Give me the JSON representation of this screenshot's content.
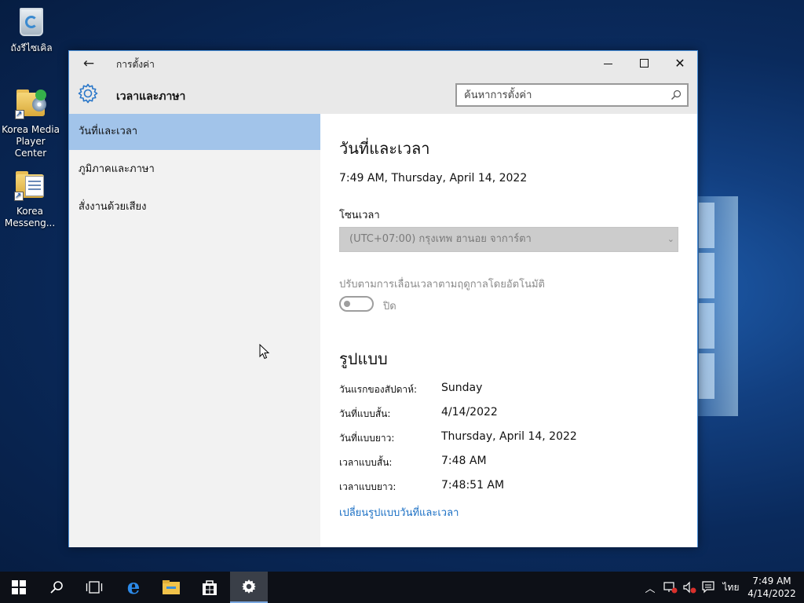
{
  "desktop": {
    "icons": [
      {
        "label": "ถังรีไซเคิล"
      },
      {
        "label": "Korea Media Player Center"
      },
      {
        "label": "Korea Messeng..."
      }
    ]
  },
  "window": {
    "title": "การตั้งค่า",
    "section_title": "เวลาและภาษา",
    "search_placeholder": "ค้นหาการตั้งค่า"
  },
  "nav": {
    "items": [
      {
        "label": "วันที่และเวลา",
        "active": true
      },
      {
        "label": "ภูมิภาคและภาษา",
        "active": false
      },
      {
        "label": "สั่งงานด้วยเสียง",
        "active": false
      }
    ]
  },
  "content": {
    "heading": "วันที่และเวลา",
    "current_datetime": "7:49 AM, Thursday, April 14, 2022",
    "timezone_label": "โซนเวลา",
    "timezone_value": "(UTC+07:00) กรุงเทพ ฮานอย จาการ์ตา",
    "dst_label": "ปรับตามการเลื่อนเวลาตามฤดูกาลโดยอัตโนมัติ",
    "dst_state": "ปิด",
    "format_heading": "รูปแบบ",
    "formats": [
      {
        "key": "วันแรกของสัปดาห์:",
        "value": "Sunday"
      },
      {
        "key": "วันที่แบบสั้น:",
        "value": "4/14/2022"
      },
      {
        "key": "วันที่แบบยาว:",
        "value": "Thursday, April 14, 2022"
      },
      {
        "key": "เวลาแบบสั้น:",
        "value": "7:48 AM"
      },
      {
        "key": "เวลาแบบยาว:",
        "value": "7:48:51 AM"
      }
    ],
    "change_link": "เปลี่ยนรูปแบบวันที่และเวลา"
  },
  "taskbar": {
    "language": "ไทย",
    "time": "7:49 AM",
    "date": "4/14/2022"
  },
  "colors": {
    "accent": "#1a6fc4",
    "nav_active": "#a2c4ea",
    "taskbar": "#0d1017"
  }
}
